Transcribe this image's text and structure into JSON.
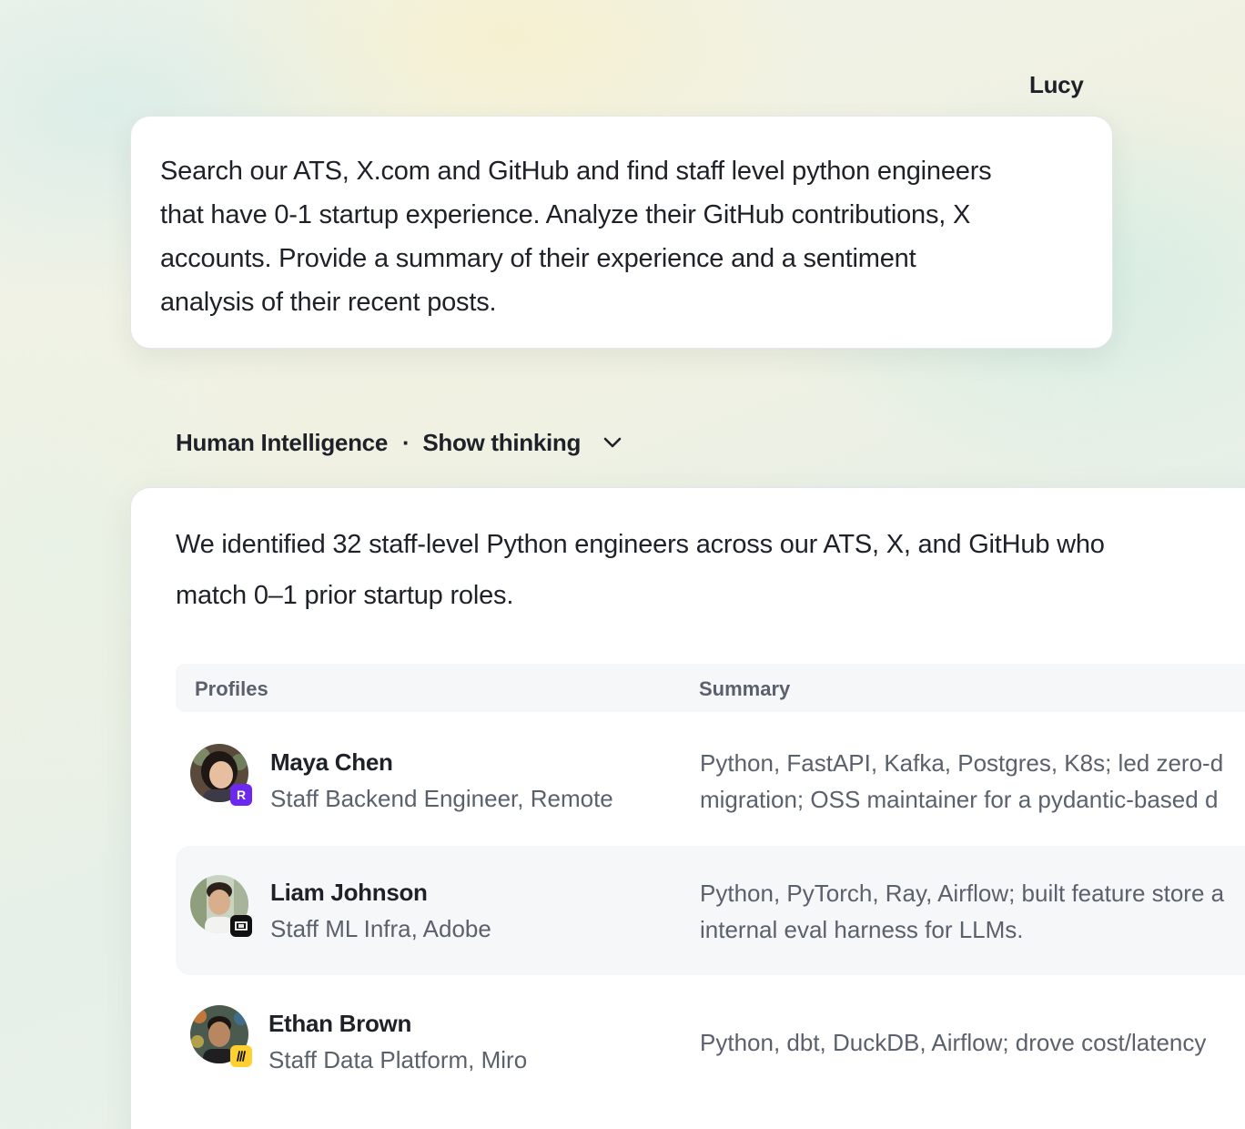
{
  "user_message": {
    "sender": "Lucy",
    "lines": [
      "Search our ATS, X.com and GitHub and find staff level python engineers",
      "that have 0-1 startup experience. Analyze their GitHub contributions, X",
      "accounts. Provide a summary of their experience and a sentiment",
      "analysis of their recent posts."
    ]
  },
  "assistant": {
    "name": "Human Intelligence",
    "separator": "·",
    "show_thinking_label": "Show thinking",
    "intro_lines": [
      "We identified 32 staff-level Python engineers across our ATS, X, and GitHub who",
      "match 0–1 prior startup roles."
    ]
  },
  "table": {
    "headers": {
      "profiles": "Profiles",
      "summary": "Summary"
    },
    "rows": [
      {
        "name": "Maya Chen",
        "role": "Staff Backend Engineer, Remote",
        "company_badge_icon": "rippling-logo-icon",
        "badge_text": "R",
        "summary_lines": [
          "Python, FastAPI, Kafka, Postgres, K8s; led zero-d",
          "migration; OSS maintainer for a pydantic-based d"
        ]
      },
      {
        "name": "Liam Johnson",
        "role": "Staff ML Infra, Adobe",
        "company_badge_icon": "adobe-logo-icon",
        "badge_text": "",
        "summary_lines": [
          "Python, PyTorch, Ray, Airflow; built feature store a",
          "internal eval harness for LLMs."
        ]
      },
      {
        "name": "Ethan Brown",
        "role": "Staff Data Platform, Miro",
        "company_badge_icon": "miro-logo-icon",
        "badge_text": "",
        "summary_lines": [
          "Python, dbt, DuckDB, Airflow; drove cost/latency"
        ]
      }
    ]
  },
  "colors": {
    "text_primary": "#1f2128",
    "text_secondary": "#5b616c",
    "row_alt_background": "#f6f7f9",
    "rippling_badge": "#6d28f0",
    "adobe_badge": "#111111",
    "miro_badge": "#ffd02f"
  }
}
